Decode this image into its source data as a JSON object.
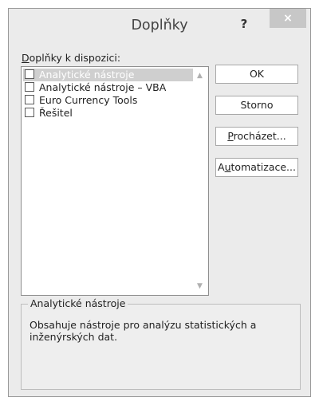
{
  "window": {
    "title": "Doplňky",
    "help_label": "?",
    "close_label": "×"
  },
  "addins_list": {
    "label_accesskey": "D",
    "label_rest": "oplňky k dispozici:",
    "items": [
      {
        "label": "Analytické nástroje",
        "checked": false,
        "selected": true
      },
      {
        "label": "Analytické nástroje – VBA",
        "checked": false,
        "selected": false
      },
      {
        "label": "Euro Currency Tools",
        "checked": false,
        "selected": false
      },
      {
        "label": "Řešitel",
        "checked": false,
        "selected": false
      }
    ],
    "scroll_up_icon": "chevron-up-icon",
    "scroll_down_icon": "chevron-down-icon"
  },
  "buttons": {
    "ok": {
      "label": "OK"
    },
    "cancel": {
      "label": "Storno"
    },
    "browse": {
      "accesskey": "P",
      "rest": "rocházet..."
    },
    "automation": {
      "before": "A",
      "accesskey": "u",
      "rest": "tomatizace..."
    }
  },
  "description": {
    "title": "Analytické nástroje",
    "text": "Obsahuje nástroje pro analýzu statistických a inženýrských dat."
  },
  "colors": {
    "dialog_bg": "#ebebeb",
    "selection_bg": "#cfcfcf",
    "close_button_bg": "#c7c7c7"
  }
}
